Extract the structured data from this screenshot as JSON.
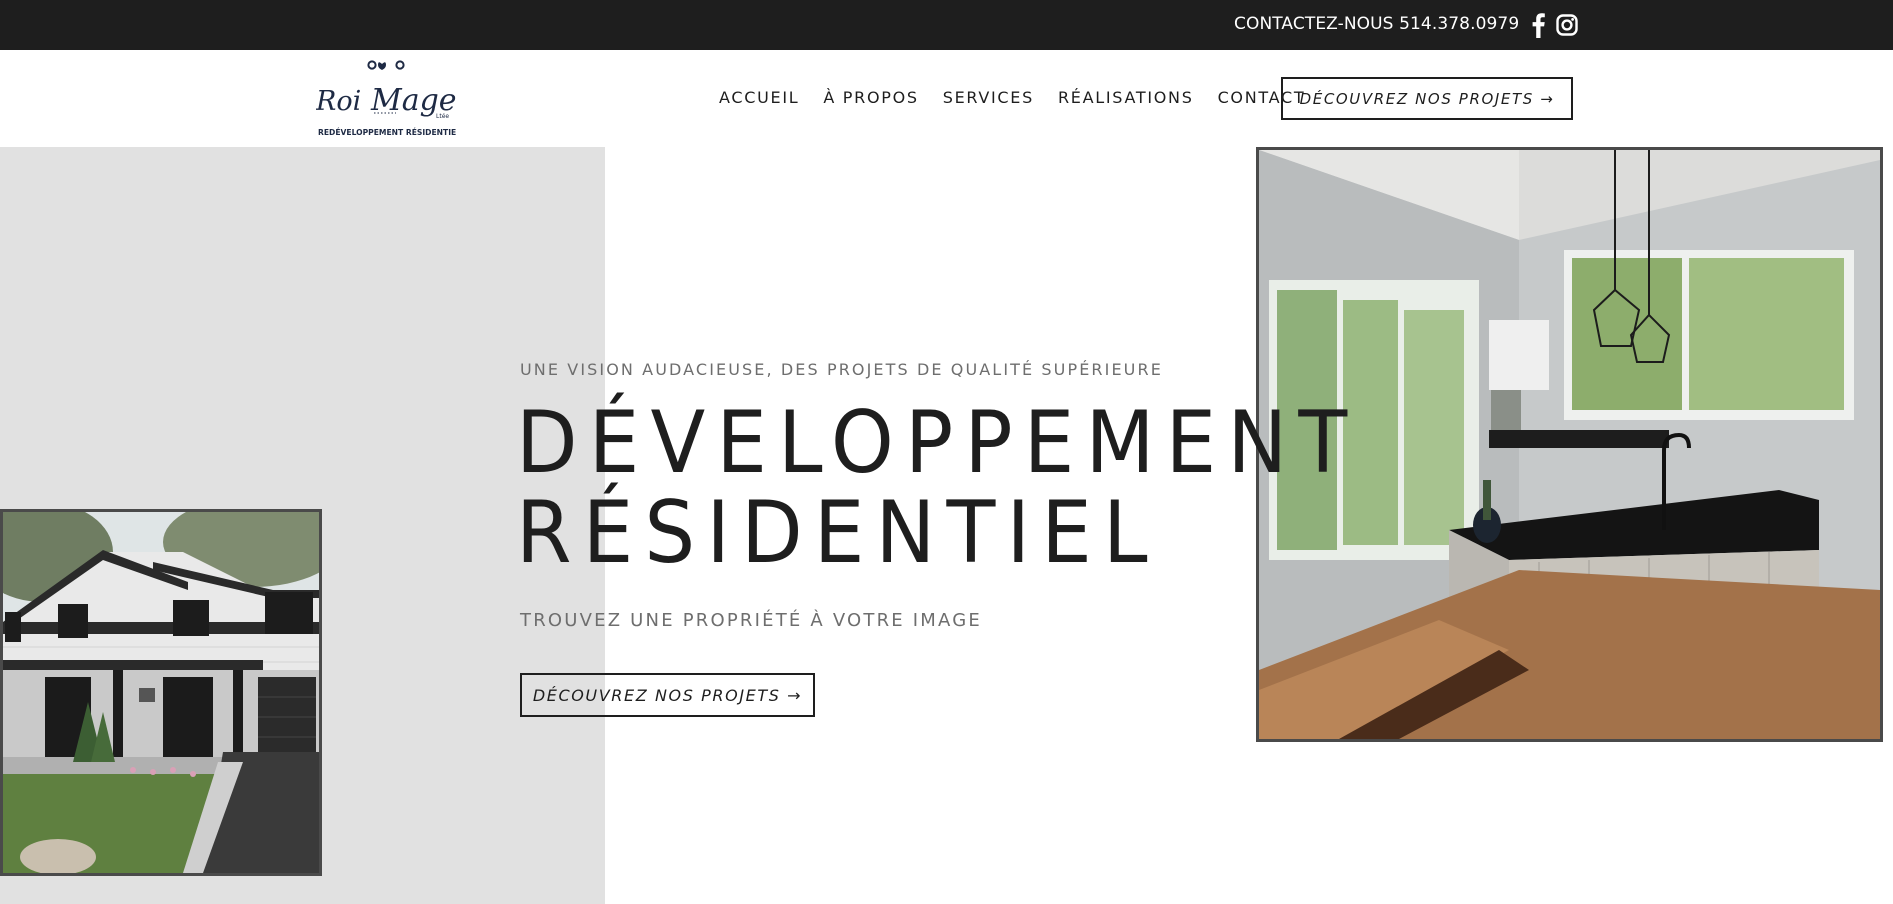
{
  "topbar": {
    "contact_text": "CONTACTEZ-NOUS 514.378.0979",
    "icons": [
      "facebook-icon",
      "instagram-icon"
    ]
  },
  "header": {
    "logo": {
      "brand_line1": "Roi",
      "brand_line2": "Mage",
      "suffix": "Ltée",
      "tagline": "REDÉVELOPPEMENT RÉSIDENTIEL"
    },
    "nav": [
      {
        "label": "ACCUEIL"
      },
      {
        "label": "À PROPOS"
      },
      {
        "label": "SERVICES"
      },
      {
        "label": "RÉALISATIONS"
      },
      {
        "label": "CONTACT"
      }
    ],
    "cta_label": "DÉCOUVREZ NOS PROJETS →"
  },
  "hero": {
    "eyebrow": "UNE VISION AUDACIEUSE, DES PROJETS DE QUALITÉ SUPÉRIEURE",
    "headline_line1": "DÉVELOPPEMENT",
    "headline_line2": "RÉSIDENTIEL",
    "tagline": "TROUVEZ UNE PROPRIÉTÉ À VOTRE IMAGE",
    "cta_label": "DÉCOUVREZ NOS PROJETS →"
  },
  "colors": {
    "dark": "#1e1e1e",
    "muted_text": "#6e6e6e",
    "grey_block": "#e1e1e1",
    "white": "#ffffff"
  }
}
